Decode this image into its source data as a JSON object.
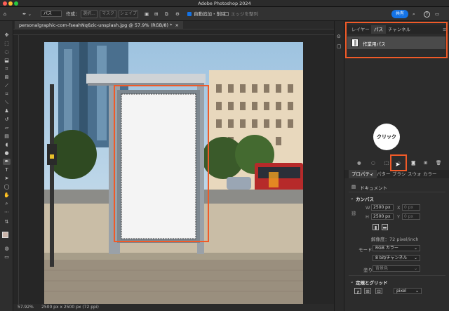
{
  "app": {
    "title": "Adobe Photoshop 2024"
  },
  "options_bar": {
    "mode_value": "パス",
    "create_label": "作成：",
    "select_button": "選択...",
    "mask_button": "マスク",
    "shape_button": "シェイプ",
    "auto_add_delete_label": "自動追加・削除",
    "align_edges_label": "エッジを整列",
    "share_button": "共有"
  },
  "document": {
    "tab_label": "personalgraphic-com-fseahNq6zic-unsplash.jpg @ 57.9% (RGB/8) *",
    "zoom": "57.92%",
    "doc_size": "2500 px x 2500 px (72 ppi)"
  },
  "paths_panel": {
    "tabs": [
      "レイヤー",
      "パス",
      "チャンネル"
    ],
    "active_tab": 1,
    "path_item": "作業用パス"
  },
  "callout": {
    "label": "クリック"
  },
  "properties_panel": {
    "tabs": [
      "プロパティ",
      "パター",
      "ブラシ",
      "スウォ",
      "カラー"
    ],
    "doc_label": "ドキュメント",
    "canvas_header": "カンバス",
    "w_label": "W",
    "w_value": "2500 px",
    "h_label": "H",
    "h_value": "2500 px",
    "x_label": "X",
    "x_value": "0 px",
    "y_label": "Y",
    "y_value": "0 px",
    "resolution": "解像度：72 pixel/inch",
    "mode_label": "モード",
    "mode_value": "RGB カラー",
    "bits_value": "8 bit/チャンネル",
    "fill_label": "塗り",
    "fill_value": "背景色",
    "rulers_header": "定規とグリッド",
    "unit_value": "pixel"
  },
  "colors": {
    "accent": "#1473e6",
    "highlight": "#f05a28"
  }
}
